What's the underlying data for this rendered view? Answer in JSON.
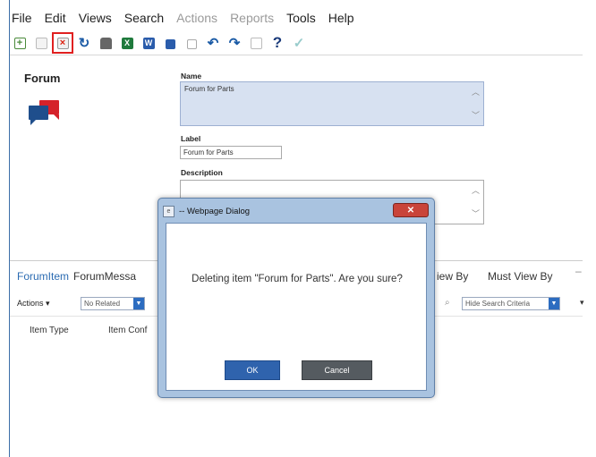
{
  "menu": [
    "File",
    "Edit",
    "Views",
    "Search",
    "Actions",
    "Reports",
    "Tools",
    "Help"
  ],
  "menu_disabled": [
    "Actions",
    "Reports"
  ],
  "toolbar": {
    "icons": [
      "add-icon",
      "page-icon",
      "delete-icon",
      "refresh-icon",
      "print-icon",
      "excel-icon",
      "word-icon",
      "lock-icon",
      "unlock-icon",
      "undo-icon",
      "redo-icon",
      "clipboard-icon",
      "help-icon",
      "check-icon"
    ]
  },
  "item": {
    "title": "Forum"
  },
  "fields": {
    "name_label": "Name",
    "name_value": "Forum for Parts",
    "label_label": "Label",
    "label_value": "Forum for Parts",
    "description_label": "Description"
  },
  "tabs": [
    "ForumItem",
    "ForumMessa",
    "iew By",
    "Must View By"
  ],
  "relations": {
    "actions_label": "Actions",
    "related_select": "No Related",
    "search_criteria_select": "Hide Search Criteria"
  },
  "columns": [
    "Item Type",
    "Item Conf"
  ],
  "dialog": {
    "title": "-- Webpage Dialog",
    "message": "Deleting item \"Forum for Parts\". Are you sure?",
    "ok": "OK",
    "cancel": "Cancel"
  },
  "colors": {
    "accent": "#2f63ad",
    "selected_field": "#d7e1f1",
    "close": "#c9443a",
    "delete_highlight": "#e02020"
  }
}
